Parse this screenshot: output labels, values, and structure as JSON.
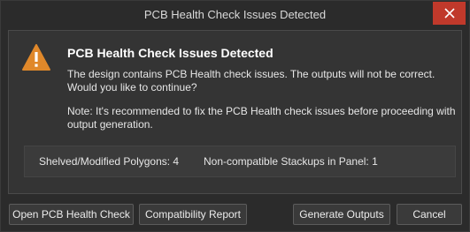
{
  "window": {
    "title": "PCB Health Check Issues Detected",
    "close_icon": "close-icon",
    "accent_close": "#c0392b"
  },
  "body": {
    "icon": "warning-icon",
    "icon_color": "#e0882a",
    "heading": "PCB Health Check Issues Detected",
    "message_line1": "The design contains PCB Health check issues. The outputs will not be correct.",
    "message_line2": "Would you like to continue?",
    "note_line1": "Note: It's recommended to fix the PCB Health check issues before proceeding with",
    "note_line2": "output generation."
  },
  "stats": {
    "shelved_polygons": "Shelved/Modified Polygons: 4",
    "noncompatible_stackups": "Non-compatible Stackups in Panel: 1"
  },
  "buttons": {
    "open_health_check": "Open PCB Health Check",
    "compatibility_report": "Compatibility Report",
    "generate_outputs": "Generate Outputs",
    "cancel": "Cancel"
  }
}
